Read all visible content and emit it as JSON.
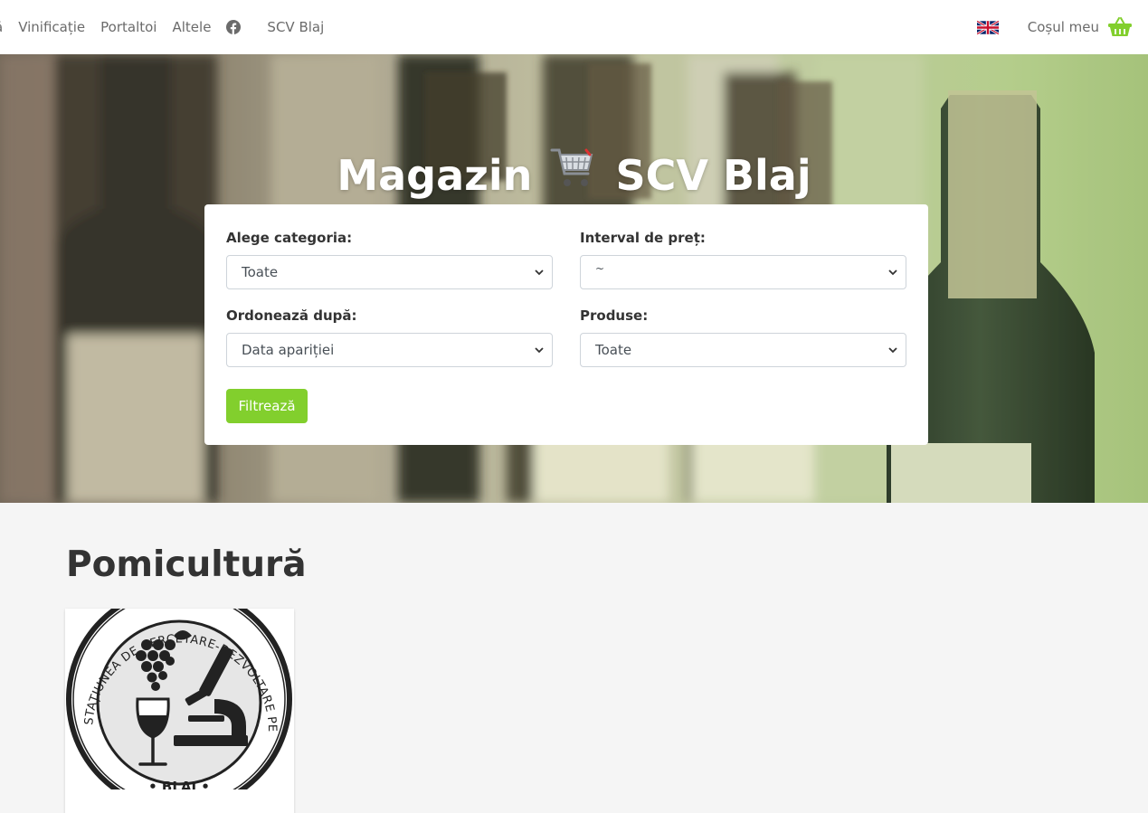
{
  "nav": {
    "items": [
      "ă",
      "Vinificație",
      "Portaltoi",
      "Altele"
    ],
    "facebook_icon": "facebook-icon",
    "brand": "SCV Blaj",
    "language_flag": "uk-flag-icon",
    "cart_label": "Coșul meu",
    "basket_icon": "basket-icon",
    "accent": "#82cf2d"
  },
  "hero": {
    "title_left": "Magazin",
    "title_icon": "shopping-cart-icon",
    "title_right": "SCV Blaj"
  },
  "filters": {
    "category_label": "Alege categoria:",
    "category_value": "Toate",
    "price_label": "Interval de preț:",
    "price_value": "~",
    "sort_label": "Ordonează după:",
    "sort_value": "Data apariției",
    "products_label": "Produse:",
    "products_value": "Toate",
    "submit_label": "Filtrează"
  },
  "category": {
    "title": "Pomicultură",
    "product": {
      "logo_text_ring": "STAȚIUNEA DE CERCETARE-DEZVOLTARE PENTRU VITICULTURĂ ȘI VINIFICAȚIE",
      "logo_text_bottom": "• BLAJ •"
    }
  }
}
